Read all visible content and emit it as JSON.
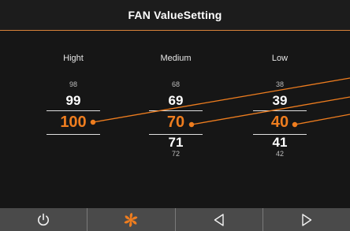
{
  "header": {
    "title": "FAN ValueSetting"
  },
  "levels": [
    {
      "label": "Hight",
      "prev2": "98",
      "prev": "99",
      "selected": "100",
      "next": "",
      "next2": ""
    },
    {
      "label": "Medium",
      "prev2": "68",
      "prev": "69",
      "selected": "70",
      "next": "71",
      "next2": "72"
    },
    {
      "label": "Low",
      "prev2": "38",
      "prev": "39",
      "selected": "40",
      "next": "41",
      "next2": "42"
    }
  ],
  "bottom_bar": {
    "items": [
      {
        "icon": "power-icon"
      },
      {
        "icon": "fan-icon",
        "active": true
      },
      {
        "icon": "arrow-left-icon"
      },
      {
        "icon": "arrow-right-icon"
      }
    ]
  },
  "colors": {
    "accent": "#ee7d1f",
    "background": "#161616",
    "bar": "#4a4a4a",
    "text": "#ffffff"
  }
}
